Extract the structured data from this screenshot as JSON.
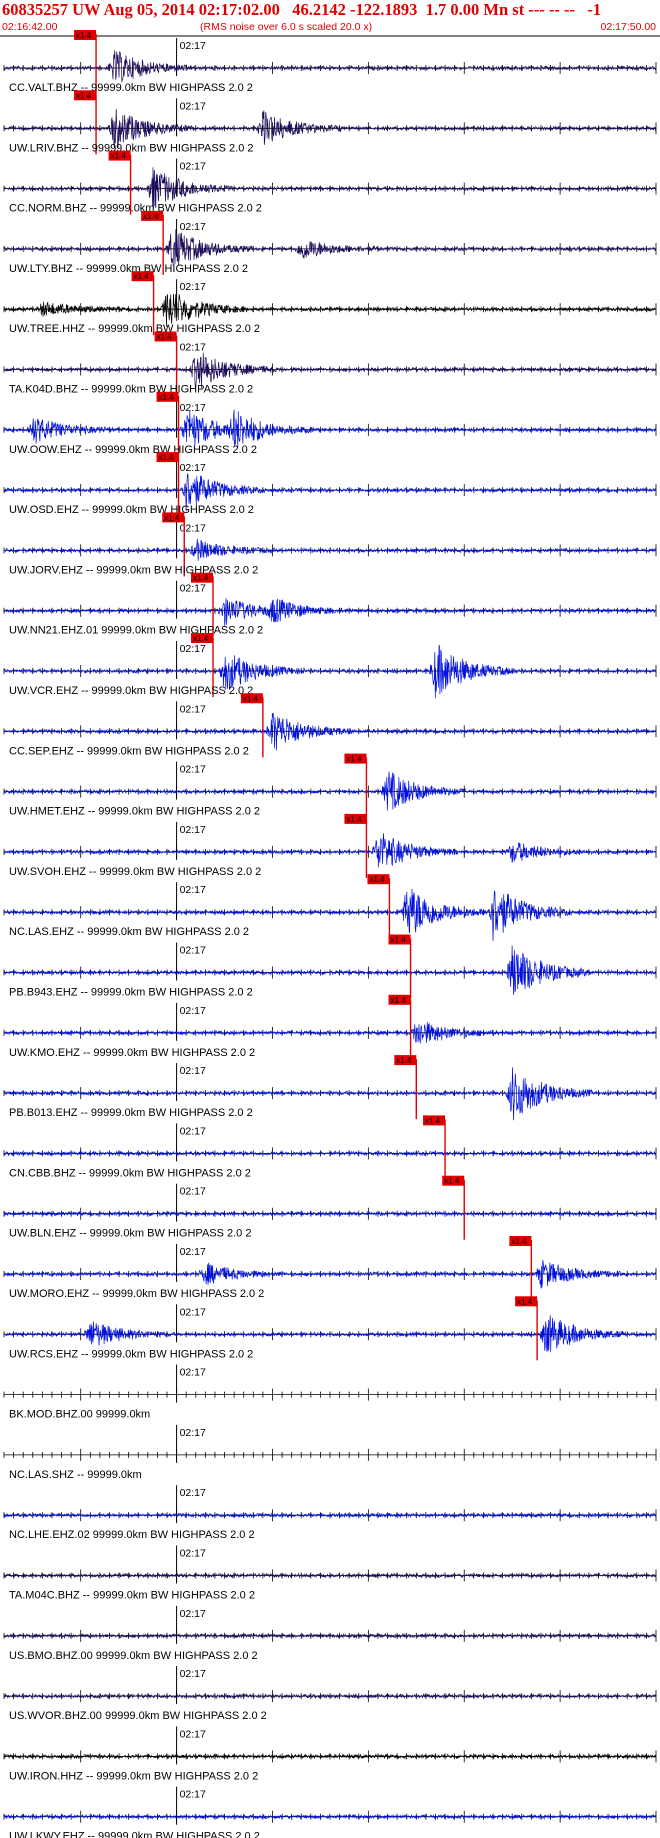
{
  "header": {
    "title": "60835257 UW Aug 05, 2014 02:17:02.00   46.2142 -122.1893  1.7 0.00 Mn st --- -- --   -1",
    "start_time": "02:16:42.00",
    "rms_note": "(RMS noise over 6.0 s scaled 20.0 x)",
    "end_time": "02:17:50.00"
  },
  "colors": {
    "header_red": "#e00000",
    "pick_red": "#e00000",
    "dark_trace": "#1c0a5a",
    "black_trace": "#000000",
    "blue_trace": "#0010e0"
  },
  "chart_data": {
    "type": "line",
    "title": "60835257 UW Aug 05, 2014 02:17:02.00   46.2142 -122.1893  1.7 0.00 Mn st --- -- --   -1",
    "x_start": "02:16:42.00",
    "x_end": "02:17:50.00",
    "tick_label": "02:17",
    "pick_label": "x1.4",
    "series": [
      {
        "name": "CC.VALT.BHZ -- 99999.0km BW  HIGHPASS  2.0  2",
        "color": "dark",
        "pick": "02:16:51.6",
        "events": [
          {
            "t": "02:16:53.5",
            "amp": 2.5
          }
        ]
      },
      {
        "name": "UW.LRIV.BHZ -- 99999.0km BW  HIGHPASS  2.0  2",
        "color": "dark",
        "pick": "02:16:51.6",
        "events": [
          {
            "t": "02:16:53.5",
            "amp": 3
          },
          {
            "t": "02:17:09",
            "amp": 2.5
          }
        ]
      },
      {
        "name": "CC.NORM.BHZ -- 99999.0km BW  HIGHPASS  2.0  2",
        "color": "dark",
        "pick": "02:16:55.2",
        "events": [
          {
            "t": "02:16:57.5",
            "amp": 3
          }
        ]
      },
      {
        "name": "UW.LTY.BHZ -- 99999.0km BW  HIGHPASS  2.0  2",
        "color": "dark",
        "pick": "02:16:58.6",
        "events": [
          {
            "t": "02:16:59.5",
            "amp": 3
          },
          {
            "t": "02:17:13",
            "amp": 1.5
          }
        ]
      },
      {
        "name": "UW.TREE.HHZ -- 99999.0km BW  HIGHPASS  2.0  2",
        "color": "black",
        "pick": "02:16:57.6",
        "events": [
          {
            "t": "02:16:59",
            "amp": 3
          },
          {
            "t": "02:16:46",
            "amp": 1
          }
        ]
      },
      {
        "name": "TA.K04D.BHZ -- 99999.0km BW  HIGHPASS  2.0  2",
        "color": "dark",
        "pick": "02:17:00.0",
        "events": [
          {
            "t": "02:17:02",
            "amp": 3
          }
        ]
      },
      {
        "name": "UW.OOW.EHZ -- 99999.0km BW  HIGHPASS  2.0  2",
        "color": "blue",
        "pick": "02:17:00.2",
        "events": [
          {
            "t": "02:17:01",
            "amp": 3
          },
          {
            "t": "02:17:06",
            "amp": 2.5
          },
          {
            "t": "02:16:45",
            "amp": 2
          }
        ]
      },
      {
        "name": "UW.OSD.EHZ -- 99999.0km BW  HIGHPASS  2.0  2",
        "color": "blue",
        "pick": "02:17:00.2",
        "events": [
          {
            "t": "02:17:01",
            "amp": 3
          }
        ]
      },
      {
        "name": "UW.JORV.EHZ -- 99999.0km BW  HIGHPASS  2.0  2",
        "color": "blue",
        "pick": "02:17:00.8",
        "events": [
          {
            "t": "02:17:02",
            "amp": 1.5
          }
        ]
      },
      {
        "name": "UW.NN21.EHZ.01 99999.0km BW  HIGHPASS  2.0  2",
        "color": "blue",
        "pick": "02:17:03.8",
        "events": [
          {
            "t": "02:17:05",
            "amp": 2
          },
          {
            "t": "02:17:10",
            "amp": 1.5
          }
        ]
      },
      {
        "name": "UW.VCR.EHZ -- 99999.0km BW  HIGHPASS  2.0  2",
        "color": "blue",
        "pick": "02:17:03.8",
        "events": [
          {
            "t": "02:17:05",
            "amp": 3
          },
          {
            "t": "02:17:27",
            "amp": 4
          }
        ]
      },
      {
        "name": "CC.SEP.EHZ -- 99999.0km BW  HIGHPASS  2.0  2",
        "color": "blue",
        "pick": "02:17:09.0",
        "events": [
          {
            "t": "02:17:10",
            "amp": 3
          }
        ]
      },
      {
        "name": "UW.HMET.EHZ -- 99999.0km BW  HIGHPASS  2.0  2",
        "color": "blue",
        "pick": "02:17:19.8",
        "events": [
          {
            "t": "02:17:22",
            "amp": 3
          }
        ]
      },
      {
        "name": "UW.SVOH.EHZ -- 99999.0km BW  HIGHPASS  2.0  2",
        "color": "blue",
        "pick": "02:17:19.8",
        "events": [
          {
            "t": "02:17:21",
            "amp": 3
          },
          {
            "t": "02:17:35",
            "amp": 1.5
          }
        ]
      },
      {
        "name": "NC.LAS.EHZ -- 99999.0km BW  HIGHPASS  2.0  2",
        "color": "blue",
        "pick": "02:17:22.2",
        "events": [
          {
            "t": "02:17:24",
            "amp": 4
          },
          {
            "t": "02:17:33",
            "amp": 4
          }
        ]
      },
      {
        "name": "PB.B943.EHZ -- 99999.0km BW  HIGHPASS  2.0  2",
        "color": "blue",
        "pick": "02:17:24.4",
        "events": [
          {
            "t": "02:17:35",
            "amp": 4
          }
        ]
      },
      {
        "name": "UW.KMO.EHZ -- 99999.0km BW  HIGHPASS  2.0  2",
        "color": "blue",
        "pick": "02:17:24.4",
        "events": [
          {
            "t": "02:17:25",
            "amp": 2
          }
        ]
      },
      {
        "name": "PB.B013.EHZ -- 99999.0km BW  HIGHPASS  2.0  2",
        "color": "blue",
        "pick": "02:17:25.0",
        "events": [
          {
            "t": "02:17:35",
            "amp": 4
          }
        ]
      },
      {
        "name": "CN.CBB.BHZ -- 99999.0km BW  HIGHPASS  2.0  2",
        "color": "blue",
        "pick": "02:17:28.0",
        "events": []
      },
      {
        "name": "UW.BLN.EHZ -- 99999.0km BW  HIGHPASS  2.0  2",
        "color": "blue",
        "pick": "02:17:30.0",
        "events": []
      },
      {
        "name": "UW.MORO.EHZ -- 99999.0km BW  HIGHPASS  2.0  2",
        "color": "blue",
        "pick": "02:17:37.0",
        "events": [
          {
            "t": "02:17:38",
            "amp": 2
          },
          {
            "t": "02:17:03",
            "amp": 1.5
          }
        ]
      },
      {
        "name": "UW.RCS.EHZ -- 99999.0km BW  HIGHPASS  2.0  2",
        "color": "blue",
        "pick": "02:17:37.6",
        "events": [
          {
            "t": "02:17:38.5",
            "amp": 3
          },
          {
            "t": "02:16:51",
            "amp": 2
          }
        ]
      },
      {
        "name": "BK.MOD.BHZ.00 99999.0km",
        "color": "none",
        "pick": null,
        "events": []
      },
      {
        "name": "NC.LAS.SHZ -- 99999.0km",
        "color": "none",
        "pick": null,
        "events": []
      },
      {
        "name": "NC.LHE.EHZ.02 99999.0km BW  HIGHPASS  2.0  2",
        "color": "blue",
        "pick": null,
        "events": []
      },
      {
        "name": "TA.M04C.BHZ -- 99999.0km BW  HIGHPASS  2.0  2",
        "color": "dark",
        "pick": null,
        "events": []
      },
      {
        "name": "US.BMO.BHZ.00 99999.0km BW  HIGHPASS  2.0  2",
        "color": "dark",
        "pick": null,
        "events": []
      },
      {
        "name": "US.WVOR.BHZ.00 99999.0km BW  HIGHPASS  2.0  2",
        "color": "dark",
        "pick": null,
        "events": []
      },
      {
        "name": "UW.IRON.HHZ -- 99999.0km BW  HIGHPASS  2.0  2",
        "color": "black",
        "pick": null,
        "events": []
      },
      {
        "name": "UW.LKWY.EHZ -- 99999.0km BW  HIGHPASS  2.0  2",
        "color": "blue",
        "pick": null,
        "events": []
      }
    ]
  }
}
